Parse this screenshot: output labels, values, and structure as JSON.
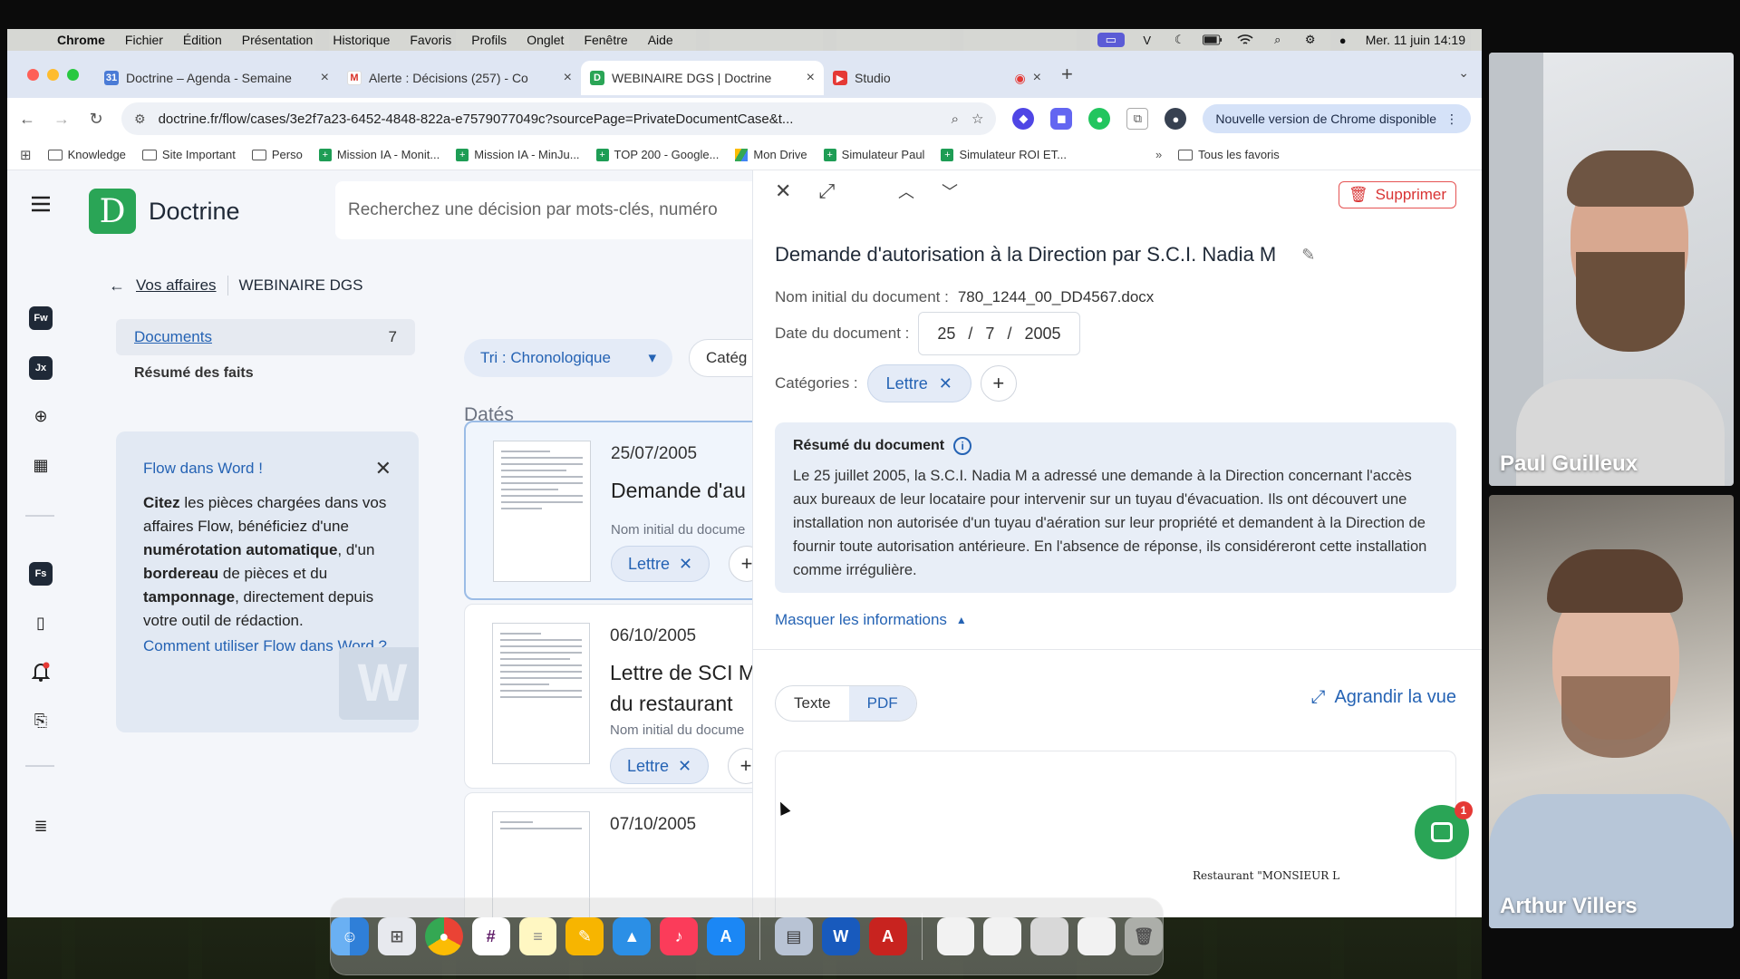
{
  "menubar": {
    "app": "Chrome",
    "items": [
      "Fichier",
      "Édition",
      "Présentation",
      "Historique",
      "Favoris",
      "Profils",
      "Onglet",
      "Fenêtre",
      "Aide"
    ],
    "clock": "Mer. 11 juin  14:19"
  },
  "tabs": [
    {
      "title": "Doctrine – Agenda - Semaine",
      "icon": "calendar-icon",
      "color": "#4a7bd6"
    },
    {
      "title": "Alerte : Décisions (257) - Co",
      "icon": "gmail-icon",
      "color": "#d93025"
    },
    {
      "title": "WEBINAIRE DGS | Doctrine",
      "icon": "doctrine-icon",
      "color": "#2aa556"
    },
    {
      "title": "Studio",
      "icon": "studio-icon",
      "color": "#e53935"
    }
  ],
  "omnibox": {
    "url": "doctrine.fr/flow/cases/3e2f7a23-6452-4848-822a-e7579077049c?sourcePage=PrivateDocumentCase&t..."
  },
  "update_label": "Nouvelle version de Chrome disponible",
  "bookmarks": [
    {
      "label": "Knowledge",
      "type": "folder"
    },
    {
      "label": "Site Important",
      "type": "folder"
    },
    {
      "label": "Perso",
      "type": "folder"
    },
    {
      "label": "Mission IA - Monit...",
      "type": "sheet"
    },
    {
      "label": "Mission IA - MinJu...",
      "type": "sheet"
    },
    {
      "label": "TOP 200 - Google...",
      "type": "sheet"
    },
    {
      "label": "Mon Drive",
      "type": "drive"
    },
    {
      "label": "Simulateur Paul",
      "type": "sheet"
    },
    {
      "label": "Simulateur ROI ET...",
      "type": "sheet"
    }
  ],
  "bookmarks_all": "Tous les favoris",
  "app": {
    "brand": "Doctrine",
    "brand_letter": "D",
    "search_placeholder": "Recherchez une décision par mots-clés, numéro",
    "rail": {
      "fw": "Fw",
      "jx": "Jx",
      "fs": "Fs"
    },
    "breadcrumb": {
      "parent": "Vos affaires",
      "current": "WEBINAIRE DGS"
    },
    "nav": {
      "documents": "Documents",
      "documents_count": "7",
      "summary": "Résumé des faits"
    },
    "promo": {
      "title": "Flow dans Word !",
      "t1": "Citez",
      "t2": " les pièces chargées dans vos affaires Flow, bénéficiez d'une ",
      "t3": "numérotation automatique",
      "t4": ", d'un ",
      "t5": "bordereau",
      "t6": " de pièces et du ",
      "t7": "tamponnage",
      "t8": ", directement depuis votre outil de rédaction.",
      "link": "Comment utiliser Flow dans Word ?"
    },
    "sort": "Tri : Chronologique",
    "category_filter": "Catég",
    "dated_header": "Datés",
    "cards": [
      {
        "date": "25/07/2005",
        "title": "Demande d'au",
        "meta": "Nom initial du docume",
        "chip": "Lettre"
      },
      {
        "date": "06/10/2005",
        "title": "Lettre de SCI M",
        "title2": "du restaurant",
        "meta": "Nom initial du docume",
        "chip": "Lettre"
      },
      {
        "date": "07/10/2005"
      }
    ],
    "detail": {
      "delete": "Supprimer",
      "title": "Demande d'autorisation à la Direction par S.C.I. Nadia M",
      "filename_label": "Nom initial du document :",
      "filename": "780_1244_00_DD4567.docx",
      "date_label": "Date du document :",
      "date_day": "25",
      "date_month": "7",
      "date_year": "2005",
      "categories_label": "Catégories :",
      "category": "Lettre",
      "summary_title": "Résumé du document",
      "summary": "Le 25 juillet 2005, la S.C.I. Nadia M a adressé une demande à la Direction concernant l'accès aux bureaux de leur locataire pour intervenir sur un tuyau d'évacuation. Ils ont découvert une installation non autorisée d'un tuyau d'aération sur leur propriété et demandent à la Direction de fournir toute autorisation antérieure. En l'absence de réponse, ils considéreront cette installation comme irrégulière.",
      "hide_info": "Masquer les informations",
      "tab_text": "Texte",
      "tab_pdf": "PDF",
      "enlarge": "Agrandir la vue",
      "preview_line": "Restaurant \"MONSIEUR L",
      "chat_badge": "1"
    }
  },
  "participants": [
    {
      "name": "Paul Guilleux"
    },
    {
      "name": "Arthur Villers"
    }
  ]
}
